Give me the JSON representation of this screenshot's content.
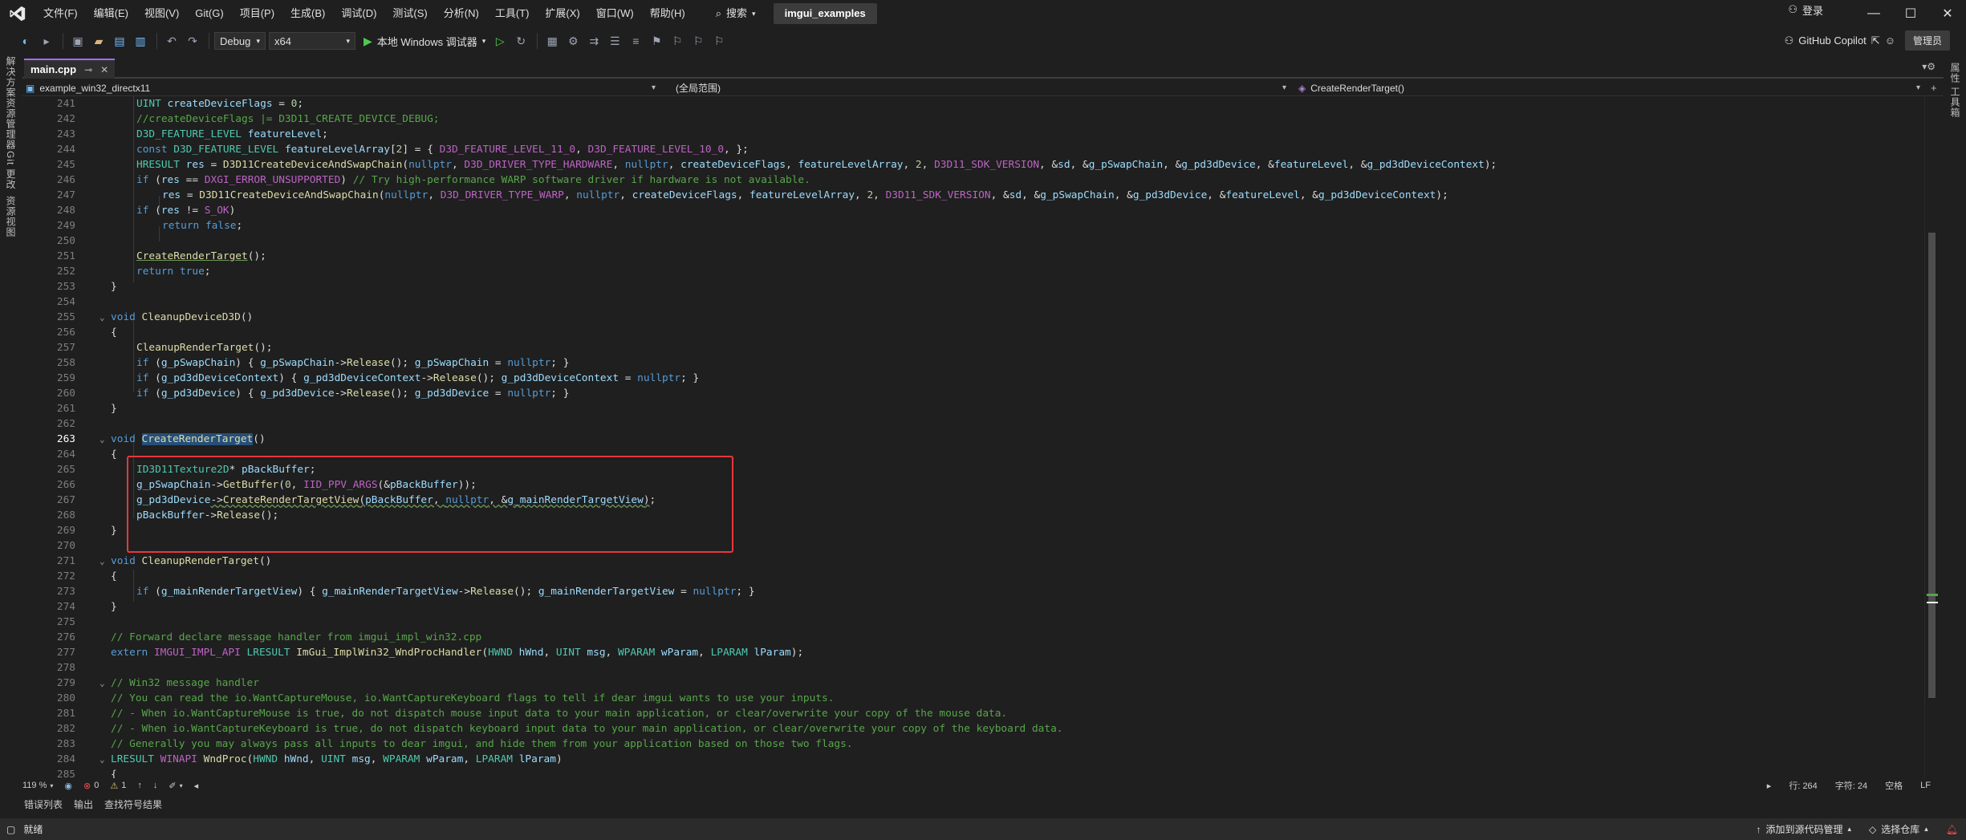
{
  "app": {
    "menu": [
      "文件(F)",
      "编辑(E)",
      "视图(V)",
      "Git(G)",
      "项目(P)",
      "生成(B)",
      "调试(D)",
      "测试(S)",
      "分析(N)",
      "工具(T)",
      "扩展(X)",
      "窗口(W)",
      "帮助(H)"
    ],
    "search_label": "搜索",
    "solution_name": "imgui_examples",
    "login_label": "登录"
  },
  "toolbar": {
    "configuration": "Debug",
    "platform": "x64",
    "run_label": "本地 Windows 调试器",
    "copilot_label": "GitHub Copilot",
    "admin_label": "管理员"
  },
  "left_panels": [
    "解决方案资源管理器",
    "Git 更改",
    "资源视图"
  ],
  "right_panels": [
    "属性",
    "工具箱"
  ],
  "document": {
    "tab_name": "main.cpp",
    "project_nav": "example_win32_directx11",
    "scope_nav": "(全局范围)",
    "member_nav": "CreateRenderTarget()"
  },
  "code_lines": [
    {
      "n": "241",
      "text": "UINT createDeviceFlags = 0;"
    },
    {
      "n": "242",
      "text": "//createDeviceFlags |= D3D11_CREATE_DEVICE_DEBUG;"
    },
    {
      "n": "243",
      "text": "D3D_FEATURE_LEVEL featureLevel;"
    },
    {
      "n": "244",
      "text": "const D3D_FEATURE_LEVEL featureLevelArray[2] = { D3D_FEATURE_LEVEL_11_0, D3D_FEATURE_LEVEL_10_0, };"
    },
    {
      "n": "245",
      "text": "HRESULT res = D3D11CreateDeviceAndSwapChain(nullptr, D3D_DRIVER_TYPE_HARDWARE, nullptr, createDeviceFlags, featureLevelArray, 2, D3D11_SDK_VERSION, &sd, &g_pSwapChain, &g_pd3dDevice, &featureLevel, &g_pd3dDeviceContext);"
    },
    {
      "n": "246",
      "text": "if (res == DXGI_ERROR_UNSUPPORTED) // Try high-performance WARP software driver if hardware is not available."
    },
    {
      "n": "247",
      "text": "res = D3D11CreateDeviceAndSwapChain(nullptr, D3D_DRIVER_TYPE_WARP, nullptr, createDeviceFlags, featureLevelArray, 2, D3D11_SDK_VERSION, &sd, &g_pSwapChain, &g_pd3dDevice, &featureLevel, &g_pd3dDeviceContext);"
    },
    {
      "n": "248",
      "text": "if (res != S_OK)"
    },
    {
      "n": "249",
      "text": "return false;"
    },
    {
      "n": "250",
      "text": ""
    },
    {
      "n": "251",
      "text": "CreateRenderTarget();"
    },
    {
      "n": "252",
      "text": "return true;"
    },
    {
      "n": "253",
      "text": "}"
    },
    {
      "n": "254",
      "text": ""
    },
    {
      "n": "255",
      "text": "void CleanupDeviceD3D()"
    },
    {
      "n": "256",
      "text": "{"
    },
    {
      "n": "257",
      "text": "CleanupRenderTarget();"
    },
    {
      "n": "258",
      "text": "if (g_pSwapChain) { g_pSwapChain->Release(); g_pSwapChain = nullptr; }"
    },
    {
      "n": "259",
      "text": "if (g_pd3dDeviceContext) { g_pd3dDeviceContext->Release(); g_pd3dDeviceContext = nullptr; }"
    },
    {
      "n": "260",
      "text": "if (g_pd3dDevice) { g_pd3dDevice->Release(); g_pd3dDevice = nullptr; }"
    },
    {
      "n": "261",
      "text": "}"
    },
    {
      "n": "262",
      "text": ""
    },
    {
      "n": "263",
      "text": "void CreateRenderTarget()"
    },
    {
      "n": "264",
      "text": "{"
    },
    {
      "n": "265",
      "text": "ID3D11Texture2D* pBackBuffer;"
    },
    {
      "n": "266",
      "text": "g_pSwapChain->GetBuffer(0, IID_PPV_ARGS(&pBackBuffer));"
    },
    {
      "n": "267",
      "text": "g_pd3dDevice->CreateRenderTargetView(pBackBuffer, nullptr, &g_mainRenderTargetView);"
    },
    {
      "n": "268",
      "text": "pBackBuffer->Release();"
    },
    {
      "n": "269",
      "text": "}"
    },
    {
      "n": "270",
      "text": ""
    },
    {
      "n": "271",
      "text": "void CleanupRenderTarget()"
    },
    {
      "n": "272",
      "text": "{"
    },
    {
      "n": "273",
      "text": "if (g_mainRenderTargetView) { g_mainRenderTargetView->Release(); g_mainRenderTargetView = nullptr; }"
    },
    {
      "n": "274",
      "text": "}"
    },
    {
      "n": "275",
      "text": ""
    },
    {
      "n": "276",
      "text": "// Forward declare message handler from imgui_impl_win32.cpp"
    },
    {
      "n": "277",
      "text": "extern IMGUI_IMPL_API LRESULT ImGui_ImplWin32_WndProcHandler(HWND hWnd, UINT msg, WPARAM wParam, LPARAM lParam);"
    },
    {
      "n": "278",
      "text": ""
    },
    {
      "n": "279",
      "text": "// Win32 message handler"
    },
    {
      "n": "280",
      "text": "// You can read the io.WantCaptureMouse, io.WantCaptureKeyboard flags to tell if dear imgui wants to use your inputs."
    },
    {
      "n": "281",
      "text": "// - When io.WantCaptureMouse is true, do not dispatch mouse input data to your main application, or clear/overwrite your copy of the mouse data."
    },
    {
      "n": "282",
      "text": "// - When io.WantCaptureKeyboard is true, do not dispatch keyboard input data to your main application, or clear/overwrite your copy of the keyboard data."
    },
    {
      "n": "283",
      "text": "// Generally you may always pass all inputs to dear imgui, and hide them from your application based on those two flags."
    },
    {
      "n": "284",
      "text": "LRESULT WINAPI WndProc(HWND hWnd, UINT msg, WPARAM wParam, LPARAM lParam)"
    },
    {
      "n": "285",
      "text": "{"
    }
  ],
  "editor_status": {
    "zoom": "119 %",
    "errors": "0",
    "warnings": "1",
    "line": "行: 264",
    "char": "字符: 24",
    "mode": "空格",
    "eol": "LF"
  },
  "bottom_tabs": [
    "错误列表",
    "输出",
    "查找符号结果"
  ],
  "statusbar": {
    "ready": "就绪",
    "source_control": "添加到源代码管理",
    "select_repo": "选择仓库"
  },
  "colors": {
    "accent": "#a66cff",
    "highlight_box": "#e8373c",
    "selection": "#264f78"
  }
}
